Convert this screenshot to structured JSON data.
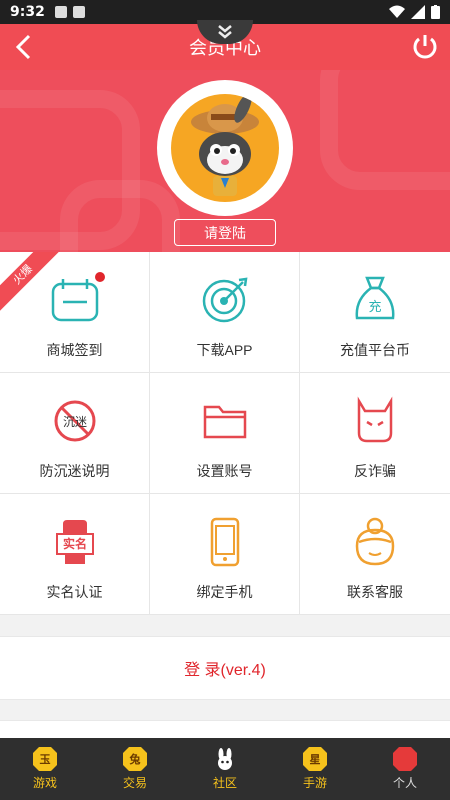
{
  "status_bar": {
    "time": "9:32"
  },
  "header": {
    "title": "会员中心"
  },
  "hero": {
    "login_label": "请登陆"
  },
  "ribbon": {
    "label": "火爆"
  },
  "grid": [
    {
      "label": "商城签到",
      "icon": "calendar-icon"
    },
    {
      "label": "下载APP",
      "icon": "target-icon"
    },
    {
      "label": "充值平台币",
      "icon": "money-bag-icon",
      "icon_text": "充"
    },
    {
      "label": "防沉迷说明",
      "icon": "anti-addiction-icon",
      "icon_text": "沉迷"
    },
    {
      "label": "设置账号",
      "icon": "folder-icon"
    },
    {
      "label": "反诈骗",
      "icon": "devil-icon"
    },
    {
      "label": "实名认证",
      "icon": "hand-card-icon",
      "icon_text": "实名"
    },
    {
      "label": "绑定手机",
      "icon": "phone-icon"
    },
    {
      "label": "联系客服",
      "icon": "support-agent-icon"
    }
  ],
  "login_bar": {
    "label": "登 录(ver.4)"
  },
  "tabs": [
    {
      "label": "游戏",
      "glyph": "玉"
    },
    {
      "label": "交易",
      "glyph": "兔"
    },
    {
      "label": "社区",
      "glyph": ""
    },
    {
      "label": "手游",
      "glyph": "星"
    },
    {
      "label": "个人",
      "glyph": ""
    }
  ],
  "colors": {
    "primary": "#f04c54",
    "teal": "#2ab3b3",
    "orange": "#f0a030",
    "tab_active": "#f6c21c"
  }
}
